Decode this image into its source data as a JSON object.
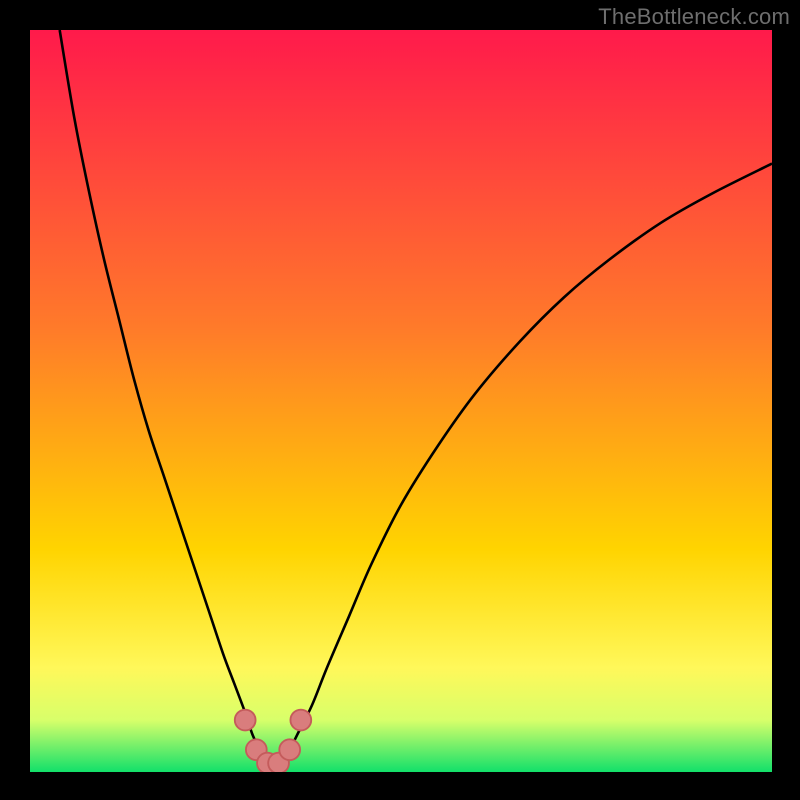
{
  "watermark": "TheBottleneck.com",
  "colors": {
    "bg": "#000000",
    "grad_top": "#ff1a4b",
    "grad_upper_mid": "#ff7a2a",
    "grad_mid": "#ffd400",
    "grad_lower_mid": "#fff85a",
    "grad_band": "#d8ff6a",
    "grad_bottom": "#12e06a",
    "curve": "#000000",
    "marker_fill": "#d97d7d",
    "marker_stroke": "#c45b5b"
  },
  "chart_data": {
    "type": "line",
    "title": "",
    "xlabel": "",
    "ylabel": "",
    "xlim": [
      0,
      100
    ],
    "ylim": [
      0,
      100
    ],
    "series": [
      {
        "name": "bottleneck-curve",
        "x": [
          4,
          6,
          8,
          10,
          12,
          14,
          16,
          18,
          20,
          22,
          24,
          26,
          27.5,
          29,
          30,
          31,
          32,
          33,
          34,
          35,
          36,
          38,
          40,
          43,
          46,
          50,
          55,
          60,
          66,
          72,
          78,
          85,
          92,
          100
        ],
        "y": [
          100,
          88,
          78,
          69,
          61,
          53,
          46,
          40,
          34,
          28,
          22,
          16,
          12,
          8,
          5,
          3,
          1.5,
          1,
          1.5,
          3,
          5,
          9,
          14,
          21,
          28,
          36,
          44,
          51,
          58,
          64,
          69,
          74,
          78,
          82
        ]
      }
    ],
    "markers": [
      {
        "x": 29.0,
        "y": 7.0
      },
      {
        "x": 30.5,
        "y": 3.0
      },
      {
        "x": 32.0,
        "y": 1.2
      },
      {
        "x": 33.5,
        "y": 1.2
      },
      {
        "x": 35.0,
        "y": 3.0
      },
      {
        "x": 36.5,
        "y": 7.0
      }
    ],
    "gradient_stops": [
      {
        "offset": 0.0,
        "key": "grad_top"
      },
      {
        "offset": 0.4,
        "key": "grad_upper_mid"
      },
      {
        "offset": 0.7,
        "key": "grad_mid"
      },
      {
        "offset": 0.86,
        "key": "grad_lower_mid"
      },
      {
        "offset": 0.93,
        "key": "grad_band"
      },
      {
        "offset": 1.0,
        "key": "grad_bottom"
      }
    ]
  }
}
